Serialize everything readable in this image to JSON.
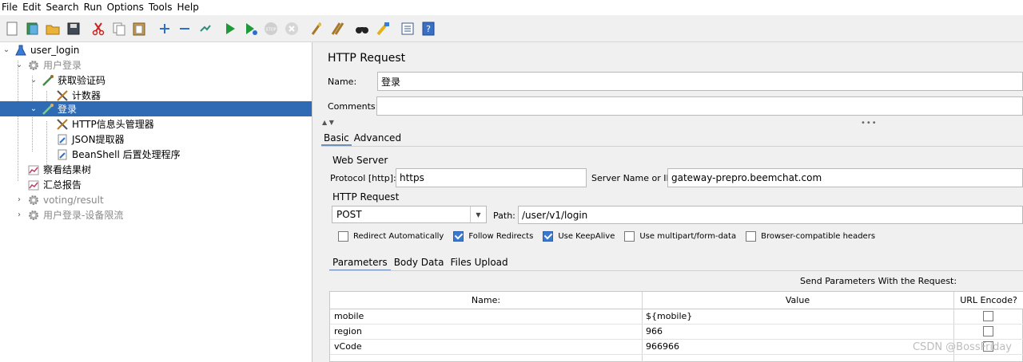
{
  "menu": [
    "File",
    "Edit",
    "Search",
    "Run",
    "Options",
    "Tools",
    "Help"
  ],
  "toolbar_icons": [
    "new-icon",
    "templates-icon",
    "open-icon",
    "save-icon",
    "cut-icon",
    "copy-icon",
    "paste-icon",
    "expand-icon",
    "collapse-icon",
    "toggle-icon",
    "start-icon",
    "start-no-pause-icon",
    "stop-icon",
    "shutdown-icon",
    "clear-icon",
    "clear-all-icon",
    "search-icon",
    "reset-search-icon",
    "function-helper-icon",
    "help-icon"
  ],
  "tree": {
    "items": [
      {
        "label": "user_login",
        "level": 0,
        "expanded": true,
        "icon": "test-plan-icon",
        "disabled": false,
        "selected": false
      },
      {
        "label": "用户登录",
        "level": 1,
        "expanded": true,
        "icon": "thread-group-icon",
        "disabled": true,
        "selected": false
      },
      {
        "label": "获取验证码",
        "level": 2,
        "expanded": true,
        "icon": "sampler-icon",
        "disabled": false,
        "selected": false
      },
      {
        "label": "计数器",
        "level": 3,
        "expanded": null,
        "icon": "config-icon",
        "disabled": false,
        "selected": false
      },
      {
        "label": "登录",
        "level": 2,
        "expanded": true,
        "icon": "sampler-icon",
        "disabled": false,
        "selected": true
      },
      {
        "label": "HTTP信息头管理器",
        "level": 3,
        "expanded": null,
        "icon": "config-icon",
        "disabled": false,
        "selected": false
      },
      {
        "label": "JSON提取器",
        "level": 3,
        "expanded": null,
        "icon": "postprocessor-icon",
        "disabled": false,
        "selected": false
      },
      {
        "label": "BeanShell 后置处理程序",
        "level": 3,
        "expanded": null,
        "icon": "postprocessor-icon",
        "disabled": false,
        "selected": false
      },
      {
        "label": "察看结果树",
        "level": 1,
        "expanded": null,
        "icon": "listener-icon",
        "disabled": false,
        "selected": false
      },
      {
        "label": "汇总报告",
        "level": 1,
        "expanded": null,
        "icon": "listener-icon",
        "disabled": false,
        "selected": false
      },
      {
        "label": "voting/result",
        "level": 1,
        "expanded": false,
        "icon": "thread-group-icon",
        "disabled": true,
        "selected": false
      },
      {
        "label": "用户登录-设备限流",
        "level": 1,
        "expanded": false,
        "icon": "thread-group-icon",
        "disabled": true,
        "selected": false
      }
    ]
  },
  "panel": {
    "title": "HTTP Request",
    "name_label": "Name:",
    "name_value": "登录",
    "comments_label": "Comments:",
    "comments_value": "",
    "tabs": [
      "Basic",
      "Advanced"
    ],
    "web_server": {
      "title": "Web Server",
      "protocol_label": "Protocol [http]:",
      "protocol_value": "https",
      "server_label": "Server Name or IP:",
      "server_value": "gateway-prepro.beemchat.com"
    },
    "http_request": {
      "title": "HTTP Request",
      "method": "POST",
      "path_label": "Path:",
      "path_value": "/user/v1/login"
    },
    "checkboxes": [
      {
        "label": "Redirect Automatically",
        "checked": false
      },
      {
        "label": "Follow Redirects",
        "checked": true
      },
      {
        "label": "Use KeepAlive",
        "checked": true
      },
      {
        "label": "Use multipart/form-data",
        "checked": false
      },
      {
        "label": "Browser-compatible headers",
        "checked": false
      }
    ],
    "subtabs": [
      "Parameters",
      "Body Data",
      "Files Upload"
    ],
    "send_label": "Send Parameters With the Request:",
    "table": {
      "headers": [
        "Name:",
        "Value",
        "URL Encode?"
      ],
      "rows": [
        {
          "name": "mobile",
          "value": "${mobile}",
          "encode": false
        },
        {
          "name": "region",
          "value": "966",
          "encode": false
        },
        {
          "name": "vCode",
          "value": "966966",
          "encode": false
        }
      ]
    }
  },
  "watermark": "CSDN @BossFriday"
}
